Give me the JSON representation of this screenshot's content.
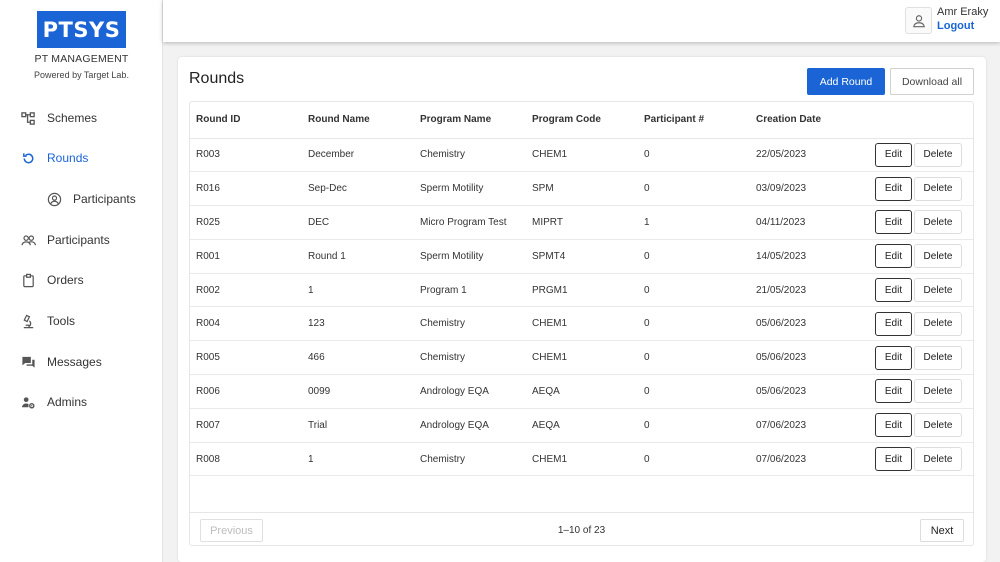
{
  "brand": {
    "logo_text": "PTSYS",
    "subtitle": "PT MANAGEMENT",
    "powered_by": "Powered by Target Lab."
  },
  "colors": {
    "accent": "#1a64d6",
    "sidebar_bg": "#ffffff",
    "page_bg": "#f2f2f2"
  },
  "sidebar": {
    "items": [
      {
        "label": "Schemes",
        "icon": "hierarchy-icon",
        "active": false
      },
      {
        "label": "Rounds",
        "icon": "refresh-icon",
        "active": true
      },
      {
        "label": "Participants",
        "icon": "person-circle-icon",
        "active": false,
        "sub": true
      },
      {
        "label": "Participants",
        "icon": "group-icon",
        "active": false
      },
      {
        "label": "Orders",
        "icon": "clipboard-icon",
        "active": false
      },
      {
        "label": "Tools",
        "icon": "microscope-icon",
        "active": false
      },
      {
        "label": "Messages",
        "icon": "chat-icon",
        "active": false
      },
      {
        "label": "Admins",
        "icon": "admin-gear-icon",
        "active": false
      }
    ]
  },
  "header": {
    "user_name": "Amr Eraky",
    "logout_label": "Logout"
  },
  "main": {
    "title": "Rounds",
    "add_label": "Add Round",
    "download_label": "Download all",
    "columns": [
      "Round ID",
      "Round Name",
      "Program Name",
      "Program Code",
      "Participant #",
      "Creation Date"
    ],
    "rows": [
      [
        "R003",
        "December",
        "Chemistry",
        "CHEM1",
        "0",
        "22/05/2023"
      ],
      [
        "R016",
        "Sep-Dec",
        "Sperm Motility",
        "SPM",
        "0",
        "03/09/2023"
      ],
      [
        "R025",
        "DEC",
        "Micro Program Test",
        "MIPRT",
        "1",
        "04/11/2023"
      ],
      [
        "R001",
        "Round 1",
        "Sperm Motility",
        "SPMT4",
        "0",
        "14/05/2023"
      ],
      [
        "R002",
        "1",
        "Program 1",
        "PRGM1",
        "0",
        "21/05/2023"
      ],
      [
        "R004",
        "123",
        "Chemistry",
        "CHEM1",
        "0",
        "05/06/2023"
      ],
      [
        "R005",
        "466",
        "Chemistry",
        "CHEM1",
        "0",
        "05/06/2023"
      ],
      [
        "R006",
        "0099",
        "Andrology EQA",
        "AEQA",
        "0",
        "05/06/2023"
      ],
      [
        "R007",
        "Trial",
        "Andrology EQA",
        "AEQA",
        "0",
        "07/06/2023"
      ],
      [
        "R008",
        "1",
        "Chemistry",
        "CHEM1",
        "0",
        "07/06/2023"
      ]
    ],
    "edit_label": "Edit",
    "delete_label": "Delete",
    "pagination": {
      "previous_label": "Previous",
      "next_label": "Next",
      "range_text": "1–10 of 23"
    }
  }
}
